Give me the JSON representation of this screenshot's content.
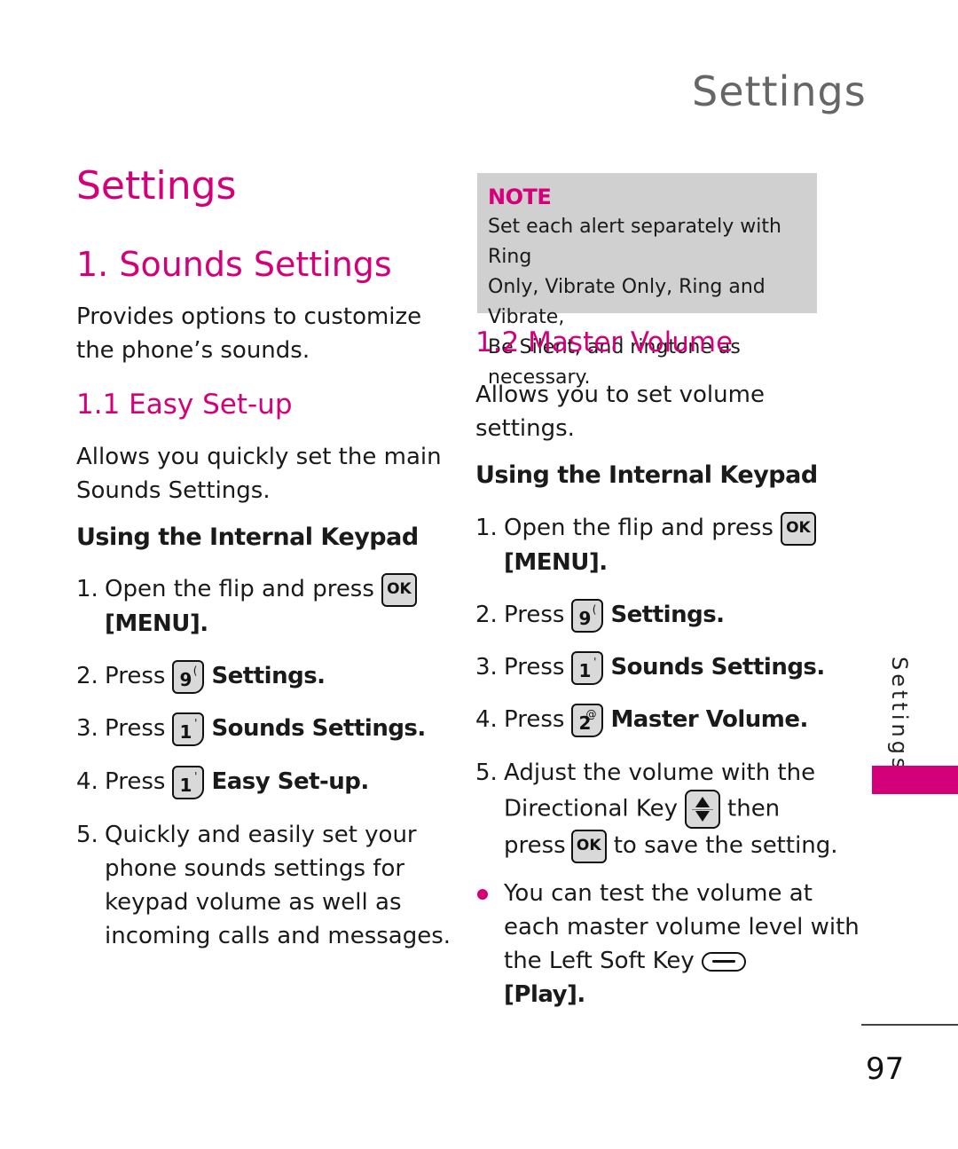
{
  "running_head": "Settings",
  "chapter_title": "Settings",
  "section": {
    "title": "1. Sounds Settings",
    "description_lines": [
      "Provides options to customize",
      "the phone’s sounds."
    ]
  },
  "easy_setup": {
    "title": "1.1 Easy Set-up",
    "description_lines": [
      "Allows you quickly set the main",
      "Sounds Settings."
    ],
    "subhead": "Using the Internal Keypad",
    "steps": [
      {
        "num": "1.",
        "text": "Open the flip and press",
        "key": "OK",
        "cont": "[MENU]."
      },
      {
        "num": "2.",
        "text": "Press",
        "key": "9",
        "key_sup": "(",
        "action": "Settings."
      },
      {
        "num": "3.",
        "text": "Press",
        "key": "1",
        "key_sup": "'",
        "action": "Sounds Settings."
      },
      {
        "num": "4.",
        "text": "Press",
        "key": "1",
        "key_sup": "'",
        "action": "Easy Set-up."
      },
      {
        "num": "5.",
        "lines": [
          "Quickly and easily set your",
          "phone sounds settings for",
          "keypad volume as well as",
          "incoming calls and messages."
        ]
      }
    ]
  },
  "note": {
    "title": "NOTE",
    "lines": [
      "Set each alert separately with Ring",
      "Only, Vibrate Only, Ring and Vibrate,",
      "Be Silent, and ringtone as necessary."
    ]
  },
  "master_volume": {
    "title": "1.2 Master Volume",
    "description_lines": [
      "Allows you to set volume",
      "settings."
    ],
    "subhead": "Using the Internal Keypad",
    "steps": [
      {
        "num": "1.",
        "text": "Open the flip and press",
        "key": "OK",
        "cont": "[MENU]."
      },
      {
        "num": "2.",
        "text": "Press",
        "key": "9",
        "key_sup": "(",
        "action": "Settings."
      },
      {
        "num": "3.",
        "text": "Press",
        "key": "1",
        "key_sup": "'",
        "action": "Sounds Settings."
      },
      {
        "num": "4.",
        "text": "Press",
        "key": "2",
        "key_sup": "@",
        "action": "Master Volume."
      },
      {
        "num": "5.",
        "line1": "Adjust the volume with the",
        "line2a": "Directional Key",
        "line2b": "then",
        "line3a": "press",
        "line3key": "OK",
        "line3b": "to save the setting."
      }
    ],
    "bullet": {
      "line1": "You can test the volume at",
      "line2": "each master volume level with",
      "line3": "the Left Soft Key",
      "line4": "[Play]."
    }
  },
  "side_tab": "Settings",
  "page_number": "97",
  "colors": {
    "accent": "#d4007a",
    "note_bg": "#d0d0d0",
    "running_head": "#666666"
  }
}
